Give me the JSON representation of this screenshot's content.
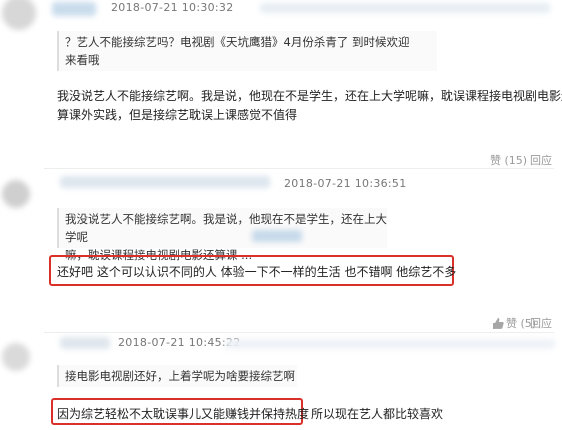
{
  "comments": [
    {
      "timestamp": "2018-07-21 10:30:32",
      "quote_line1": "？艺人不能接综艺吗？电视剧《天坑鹰猎》4月份杀青了 到时候欢迎",
      "quote_line2": "来看哦",
      "reply_line1": "我没说艺人不能接综艺啊。我是说，他现在不是学生，还在上大学呢嘛，耽误课程接电视剧电影还",
      "reply_line2": "算课外实践，但是接综艺耽误上课感觉不值得",
      "like_label": "赞 (15)",
      "reply_label": "回应"
    },
    {
      "timestamp": "2018-07-21 10:36:51",
      "quote_line1": "我没说艺人不能接综艺啊。我是说，他现在不是学生，还在上大学呢",
      "quote_line2": "嘛，耽误课程接电视剧电影还算课 ...",
      "reply_text": "还好吧 这个可以认识不同的人 体验一下不一样的生活 也不错啊 他综艺不多",
      "like_label": "赞 (5)",
      "reply_label": "回应"
    },
    {
      "timestamp": "2018-07-21 10:45:22",
      "quote_line1": "接电影电视剧还好，上着学呢为啥要接综艺啊",
      "reply_highlighted": "因为综艺轻松不太耽误事儿又能赚钱并保持热度",
      "reply_rest": "所以现在艺人都比较喜欢"
    }
  ],
  "colors": {
    "highlight_border": "#d9312a",
    "timestamp": "#777777",
    "quote_border": "#dddddd"
  },
  "icons": [
    "thumbs-up-icon"
  ]
}
